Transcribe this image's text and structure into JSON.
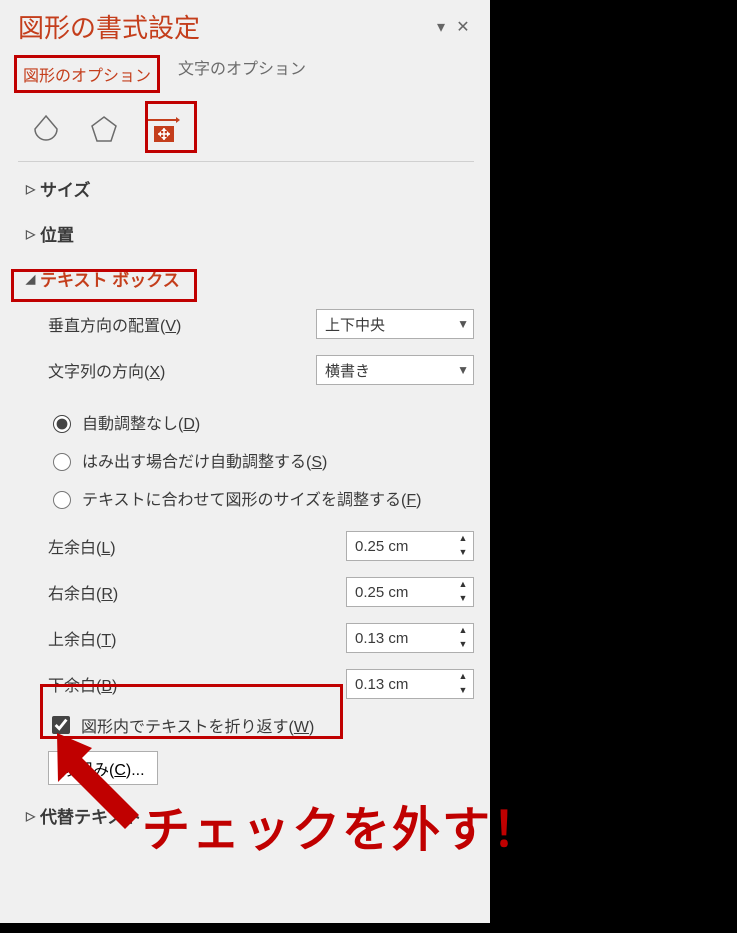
{
  "header": {
    "title": "図形の書式設定"
  },
  "tabs": {
    "shape": "図形のオプション",
    "text": "文字のオプション"
  },
  "sections": {
    "size": "サイズ",
    "position": "位置",
    "textbox": "テキスト ボックス",
    "alttext": "代替テキスト"
  },
  "textbox": {
    "valign_label": "垂直方向の配置(V)",
    "valign_value": "上下中央",
    "direction_label": "文字列の方向(X)",
    "direction_value": "横書き",
    "radio_none": "自動調整なし(D)",
    "radio_overflow": "はみ出す場合だけ自動調整する(S)",
    "radio_fit": "テキストに合わせて図形のサイズを調整する(F)",
    "margin_left_label": "左余白(L)",
    "margin_left_value": "0.25 cm",
    "margin_right_label": "右余白(R)",
    "margin_right_value": "0.25 cm",
    "margin_top_label": "上余白(T)",
    "margin_top_value": "0.13 cm",
    "margin_bottom_label": "下余白(B)",
    "margin_bottom_value": "0.13 cm",
    "wrap_label": "図形内でテキストを折り返す(W)",
    "columns_button": "段組み(C)..."
  },
  "annotation": {
    "text": "チェックを外す！"
  }
}
